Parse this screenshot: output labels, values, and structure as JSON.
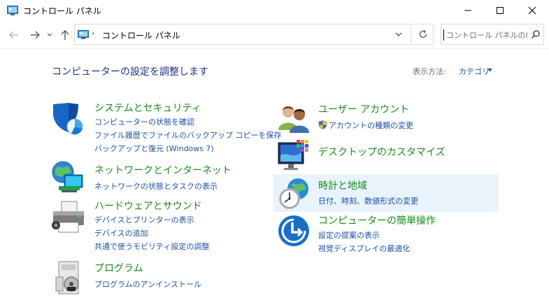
{
  "window": {
    "title": "コントロール パネル"
  },
  "address": {
    "path": "コントロール パネル",
    "separator": "›"
  },
  "search": {
    "placeholder": "コントロール パネルの検..."
  },
  "header": {
    "title": "コンピューターの設定を調整します",
    "view_label": "表示方法:",
    "view_value": "カテゴリ"
  },
  "categories": {
    "system": {
      "title": "システムとセキュリティ",
      "links": [
        "コンピューターの状態を確認",
        "ファイル履歴でファイルのバックアップ コピーを保存",
        "バックアップと復元 (Windows 7)"
      ]
    },
    "network": {
      "title": "ネットワークとインターネット",
      "links": [
        "ネットワークの状態とタスクの表示"
      ]
    },
    "hardware": {
      "title": "ハードウェアとサウンド",
      "links": [
        "デバイスとプリンターの表示",
        "デバイスの追加",
        "共通で使うモビリティ設定の調整"
      ]
    },
    "programs": {
      "title": "プログラム",
      "links": [
        "プログラムのアンインストール"
      ]
    },
    "users": {
      "title": "ユーザー アカウント",
      "links": [
        "アカウントの種類の変更"
      ]
    },
    "appearance": {
      "title": "デスクトップのカスタマイズ",
      "links": []
    },
    "clock": {
      "title": "時計と地域",
      "links": [
        "日付、時刻、数値形式の変更"
      ]
    },
    "ease": {
      "title": "コンピューターの簡単操作",
      "links": [
        "設定の提案の表示",
        "視覚ディスプレイの最適化"
      ]
    }
  },
  "colors": {
    "category_title": "#1a8b1a",
    "link": "#1e50a2",
    "page_title": "#1e3287",
    "hover_highlight": "#e8f3fb"
  },
  "icons": {
    "system": "shield-icon",
    "network": "network-globe-icon",
    "hardware": "printer-icon",
    "programs": "program-box-icon",
    "users": "users-icon",
    "appearance": "desktop-monitor-icon",
    "clock": "clock-globe-icon",
    "ease": "ease-of-access-icon"
  }
}
